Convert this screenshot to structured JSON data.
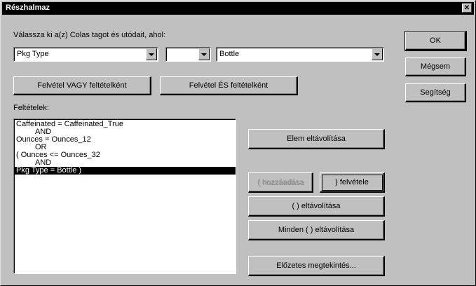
{
  "title": "Részhalmaz",
  "instruction": "Válassza ki a(z) Colas tagot és utódait, ahol:",
  "combos": {
    "field": "Pkg Type",
    "operator": "",
    "value": "Bottle"
  },
  "buttons": {
    "ok": "OK",
    "cancel": "Mégsem",
    "help": "Segítség",
    "add_or": "Felvétel VAGY feltételként",
    "add_and": "Felvétel ÉS feltételként",
    "remove_condition": "Elem eltávolítása",
    "open_paren": "( hozzáadása",
    "close_paren": ") felvétele",
    "remove_paren": "( ) eltávolítása",
    "remove_all_paren": "Minden ( ) eltávolítása",
    "preview": "Előzetes megtekintés..."
  },
  "conditions_label": "Feltételek:",
  "conditions": [
    {
      "text": "Caffeinated = Caffeinated_True",
      "indent": false,
      "selected": false
    },
    {
      "text": "AND",
      "indent": true,
      "selected": false
    },
    {
      "text": "Ounces = Ounces_12",
      "indent": false,
      "selected": false
    },
    {
      "text": "OR",
      "indent": true,
      "selected": false
    },
    {
      "text": "( Ounces <= Ounces_32",
      "indent": false,
      "selected": false
    },
    {
      "text": "AND",
      "indent": true,
      "selected": false
    },
    {
      "text": "Pkg Type = Bottle )",
      "indent": false,
      "selected": true
    }
  ]
}
